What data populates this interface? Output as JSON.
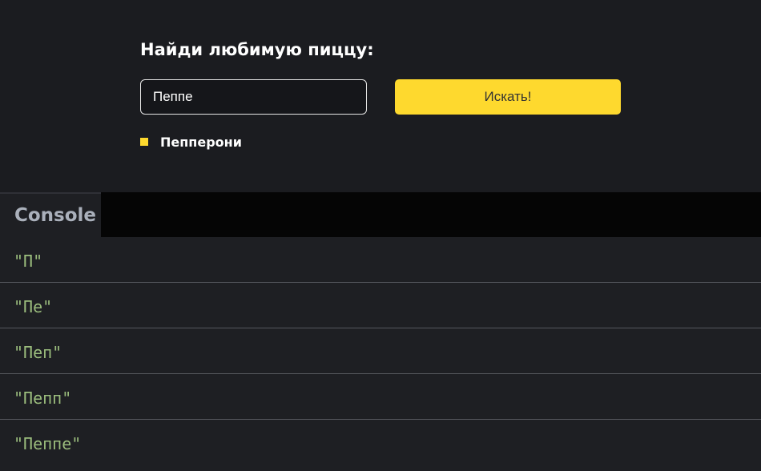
{
  "app": {
    "title": "Найди любимую пиццу:",
    "search": {
      "value": "Пеппе",
      "placeholder": ""
    },
    "search_button_label": "Искать!",
    "results": [
      {
        "label": "Пепперони"
      }
    ],
    "accent_color": "#fed92e"
  },
  "console": {
    "tab_label": "Console",
    "lines": [
      {
        "text": "\"П\""
      },
      {
        "text": "\"Пе\""
      },
      {
        "text": "\"Пеп\""
      },
      {
        "text": "\"Пепп\""
      },
      {
        "text": "\"Пеппе\""
      }
    ]
  }
}
